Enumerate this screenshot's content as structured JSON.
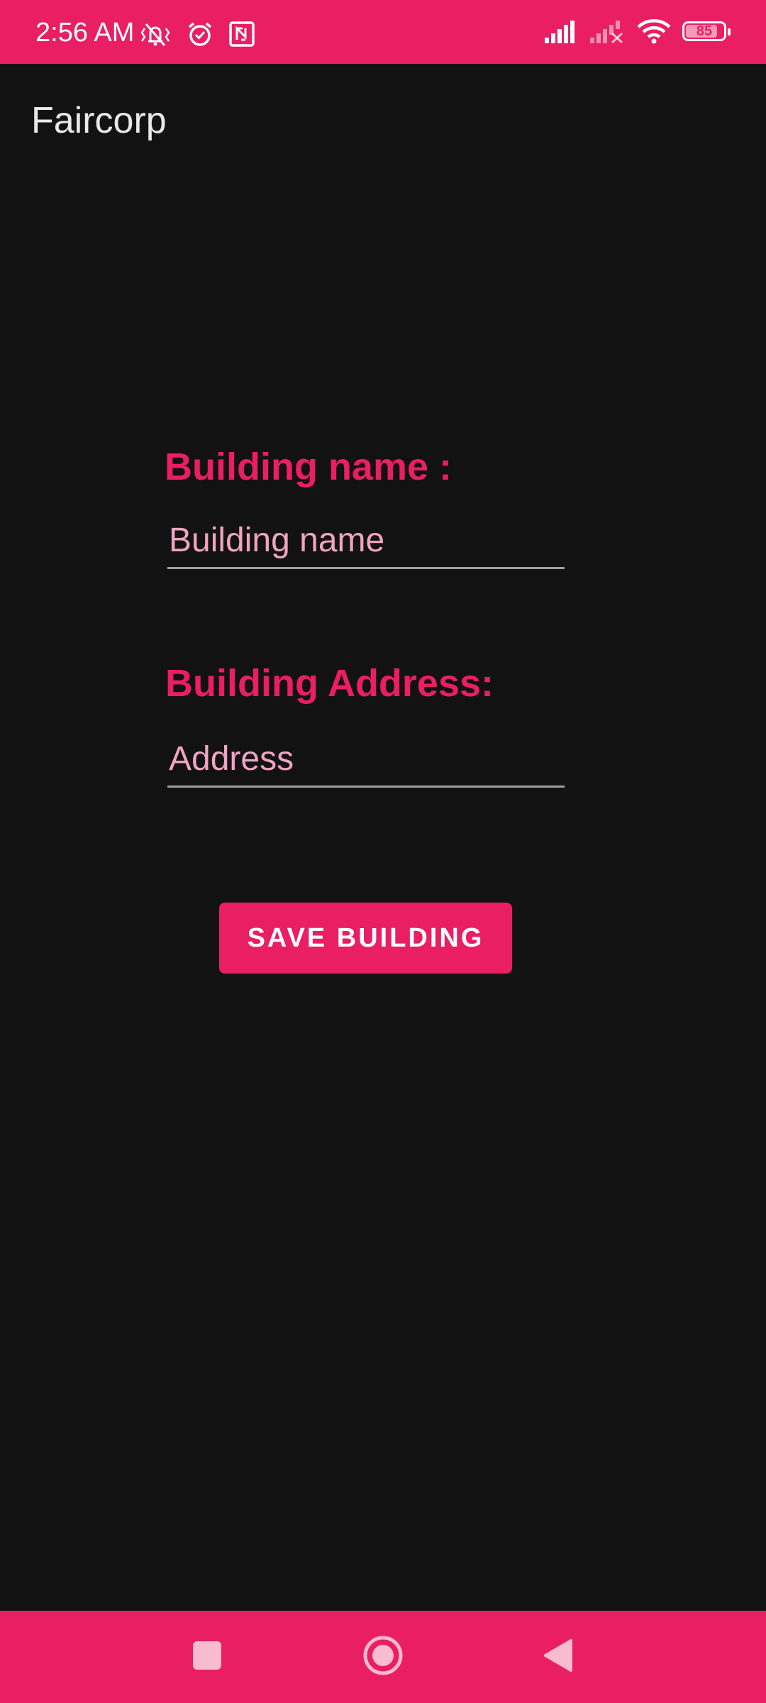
{
  "status_bar": {
    "time": "2:56 AM",
    "left_icons": [
      "vibrate-silent-icon",
      "alarm-icon",
      "nfc-icon"
    ],
    "right_icons": [
      "cell-signal-icon",
      "cell-signal-no-service-icon",
      "wifi-icon",
      "battery-icon"
    ],
    "battery_level": "85",
    "battery_fraction": 0.85
  },
  "app_bar": {
    "title": "Faircorp"
  },
  "form": {
    "name_label": "Building name :",
    "name_placeholder": "Building name",
    "name_value": "",
    "address_label": "Building Address:",
    "address_placeholder": "Address",
    "address_value": "",
    "save_label": "SAVE BUILDING"
  },
  "nav_bar": {
    "buttons": [
      "recents-icon",
      "home-icon",
      "back-icon"
    ]
  },
  "colors": {
    "accent": "#E91E63",
    "background": "#121212",
    "hint": "#F0A4C0",
    "title_text": "#E8E8E8"
  }
}
